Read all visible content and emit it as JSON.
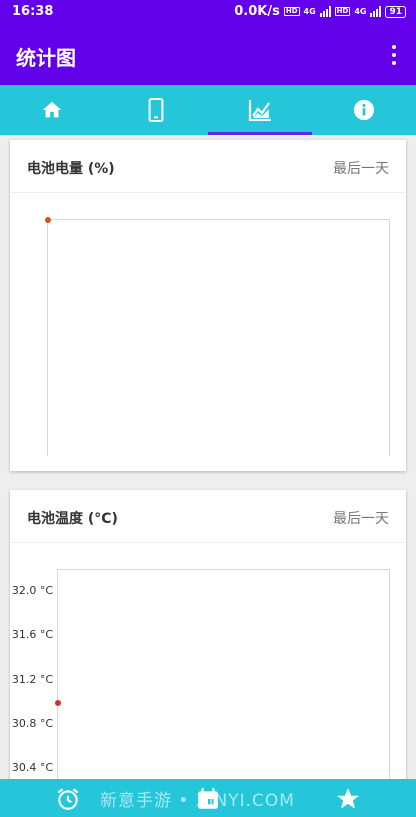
{
  "status_bar": {
    "time": "16:38",
    "speed": "0.0K/s",
    "net1": "4G",
    "net2": "4G",
    "battery": "91"
  },
  "app_bar": {
    "title": "统计图"
  },
  "tabs": [
    {
      "icon": "home-icon"
    },
    {
      "icon": "phone-icon"
    },
    {
      "icon": "chart-icon",
      "selected": true
    },
    {
      "icon": "info-icon"
    }
  ],
  "colors": {
    "primary": "#6200ea",
    "accent": "#26c6da",
    "battery_point": "#e65100",
    "temp_point": "#d32f2f"
  },
  "chart_data": [
    {
      "type": "scatter",
      "title": "电池电量 (%)",
      "range_label": "最后一天",
      "x": [
        0
      ],
      "y": [
        100
      ],
      "ylim": [
        0,
        100
      ],
      "yticks": []
    },
    {
      "type": "scatter",
      "title": "电池温度 (°C)",
      "range_label": "最后一天",
      "x": [
        0
      ],
      "y": [
        31.0
      ],
      "ylim": [
        30.2,
        32.2
      ],
      "yticks": [
        "32.0 °C",
        "31.6 °C",
        "31.2 °C",
        "30.8 °C",
        "30.4 °C"
      ]
    }
  ],
  "bottom_nav": [
    {
      "icon": "alarm-icon"
    },
    {
      "icon": "calendar-icon"
    },
    {
      "icon": "star-icon"
    }
  ],
  "watermark": "新意手游 • XINYI.COM"
}
